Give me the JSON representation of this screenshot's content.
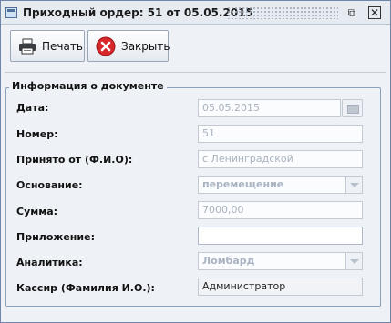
{
  "window": {
    "title": "Приходный ордер:  51 от 05.05.2015",
    "controls": {
      "restore": "⧉",
      "close": "✕"
    }
  },
  "toolbar": {
    "print_label": "Печать",
    "close_label": "Закрыть"
  },
  "section": {
    "title": "Информация о документе"
  },
  "form": {
    "date": {
      "label": "Дата:",
      "value": "05.05.2015"
    },
    "number": {
      "label": "Номер:",
      "value": "51"
    },
    "received_from": {
      "label": "Принято от (Ф.И.О):",
      "value": "с Ленинградской"
    },
    "basis": {
      "label": "Основание:",
      "value": "перемещение"
    },
    "amount": {
      "label": "Сумма:",
      "value": "7000,00"
    },
    "attachment": {
      "label": "Приложение:",
      "value": ""
    },
    "analytics": {
      "label": "Аналитика:",
      "value": "Ломбард"
    },
    "cashier": {
      "label": "Кассир (Фамилия И.О.):",
      "value": "Администратор"
    }
  },
  "icons": {
    "app": "window-icon",
    "print": "printer-icon",
    "close": "close-red-icon",
    "calendar": "calendar-icon"
  },
  "colors": {
    "window_bg": "#eef2f7",
    "border": "#8aa0bf",
    "disabled_text": "#a9b2bf",
    "close_red": "#d8282b"
  }
}
